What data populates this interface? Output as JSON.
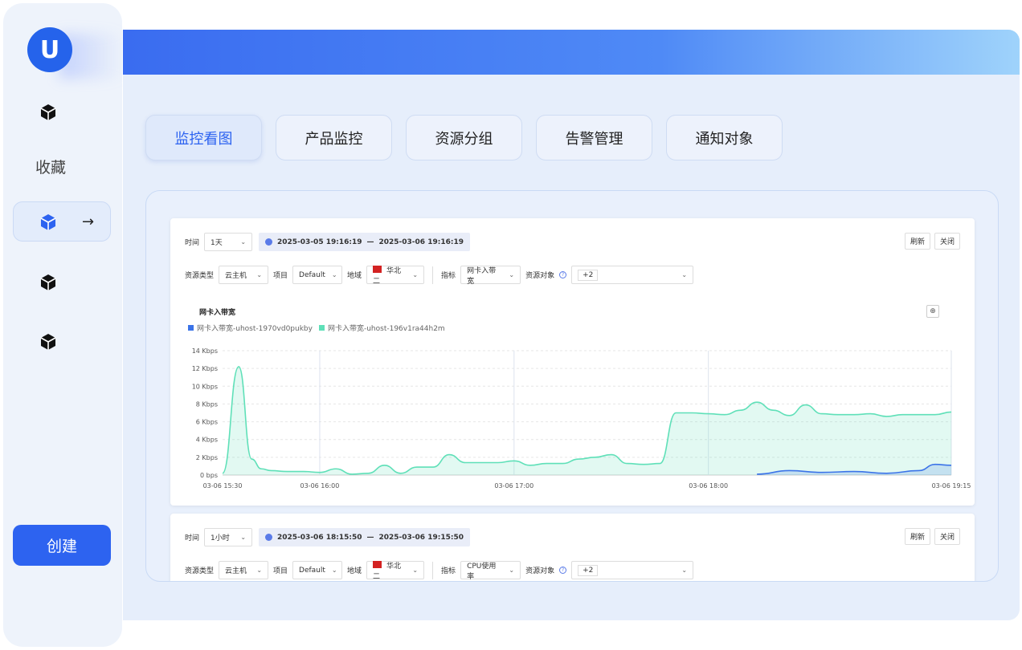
{
  "sidebar": {
    "logo_letter": "U",
    "favorites_label": "收藏",
    "arrow": "→",
    "create_label": "创建"
  },
  "tabs": [
    {
      "label": "监控看图",
      "active": true
    },
    {
      "label": "产品监控",
      "active": false
    },
    {
      "label": "资源分组",
      "active": false
    },
    {
      "label": "告警管理",
      "active": false
    },
    {
      "label": "通知对象",
      "active": false
    }
  ],
  "card1": {
    "time_label": "时间",
    "time_value": "1天",
    "range_start": "2025-03-05 19:16:19",
    "range_dash": "—",
    "range_end": "2025-03-06 19:16:19",
    "refresh": "刷新",
    "close": "关闭",
    "res_type_label": "资源类型",
    "res_type_value": "云主机",
    "project_label": "项目",
    "project_value": "Default",
    "region_label": "地域",
    "region_value": "华北二",
    "metric_label": "指标",
    "metric_value": "网卡入带宽",
    "object_label": "资源对象",
    "object_value": "+2",
    "chart_title": "网卡入带宽",
    "legend": [
      "网卡入带宽-uhost-1970vd0pukby",
      "网卡入带宽-uhost-196v1ra44h2m"
    ]
  },
  "card2": {
    "time_label": "时间",
    "time_value": "1小时",
    "range_start": "2025-03-06 18:15:50",
    "range_dash": "—",
    "range_end": "2025-03-06 19:15:50",
    "refresh": "刷新",
    "close": "关闭",
    "res_type_label": "资源类型",
    "res_type_value": "云主机",
    "project_label": "项目",
    "project_value": "Default",
    "region_label": "地域",
    "region_value": "华北二",
    "metric_label": "指标",
    "metric_value": "CPU使用率",
    "object_label": "资源对象",
    "object_value": "+2"
  },
  "colors": {
    "accent": "#2d63f0",
    "series_blue": "#3b73e8",
    "series_green": "#5fe0b8"
  },
  "chart_data": {
    "type": "area",
    "title": "网卡入带宽",
    "y_ticks": [
      "14 Kbps",
      "12 Kbps",
      "10 Kbps",
      "8 Kbps",
      "6 Kbps",
      "4 Kbps",
      "2 Kbps",
      "0 bps"
    ],
    "x_ticks": [
      "03-06 15:30",
      "03-06 16:00",
      "03-06 17:00",
      "03-06 18:00",
      "03-06 19:15"
    ],
    "ylim": [
      0,
      14
    ],
    "series": [
      {
        "name": "网卡入带宽-uhost-196v1ra44h2m",
        "x": [
          "15:30",
          "15:35",
          "15:39",
          "15:42",
          "15:45",
          "15:50",
          "15:55",
          "16:00",
          "16:05",
          "16:10",
          "16:15",
          "16:20",
          "16:25",
          "16:30",
          "16:35",
          "16:40",
          "16:45",
          "16:50",
          "16:55",
          "17:00",
          "17:05",
          "17:10",
          "17:15",
          "17:20",
          "17:25",
          "17:30",
          "17:35",
          "17:40",
          "17:45",
          "17:50",
          "17:55",
          "18:00",
          "18:05",
          "18:10",
          "18:15",
          "18:20",
          "18:25",
          "18:30",
          "18:35",
          "18:40",
          "18:45",
          "18:50",
          "18:55",
          "19:00",
          "19:05",
          "19:10",
          "19:15"
        ],
        "values": [
          0.2,
          12.2,
          1.8,
          0.7,
          0.5,
          0.4,
          0.4,
          0.3,
          0.7,
          0.1,
          0.2,
          1.1,
          0.2,
          0.9,
          0.9,
          2.3,
          1.4,
          1.4,
          1.4,
          1.6,
          1.1,
          1.3,
          1.3,
          1.8,
          2.0,
          2.3,
          1.3,
          1.2,
          1.3,
          7.0,
          7.0,
          6.9,
          6.8,
          7.3,
          8.2,
          7.3,
          6.7,
          7.9,
          6.9,
          6.8,
          6.8,
          6.9,
          6.6,
          6.8,
          6.8,
          6.8,
          7.1
        ]
      },
      {
        "name": "网卡入带宽-uhost-1970vd0pukby",
        "x": [
          "18:15",
          "18:25",
          "18:35",
          "18:45",
          "18:55",
          "19:05",
          "19:10",
          "19:15"
        ],
        "values": [
          0.1,
          0.5,
          0.3,
          0.4,
          0.2,
          0.5,
          1.2,
          1.1
        ]
      }
    ],
    "grid": true,
    "legend_position": "top-left"
  }
}
